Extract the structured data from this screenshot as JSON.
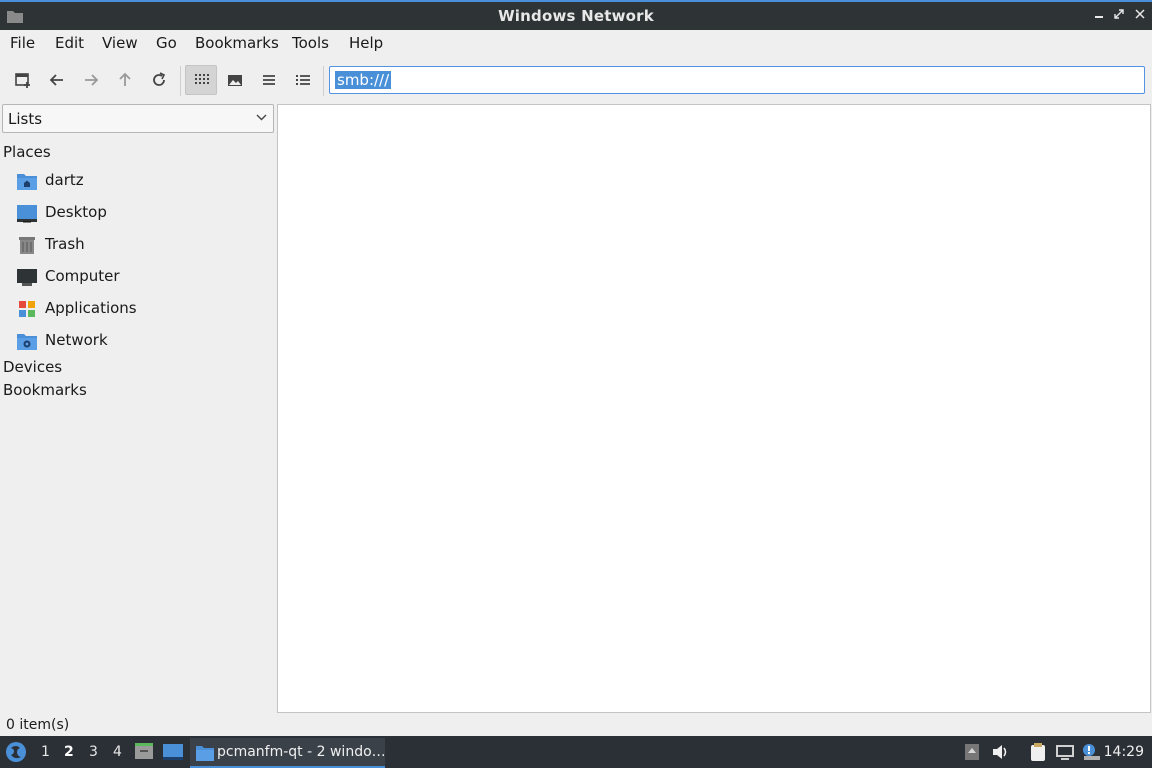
{
  "window": {
    "title": "Windows Network",
    "controls": [
      "minimize",
      "maximize",
      "close"
    ]
  },
  "menubar": {
    "items": [
      "File",
      "Edit",
      "View",
      "Go",
      "Bookmarks",
      "Tools",
      "Help"
    ]
  },
  "toolbar": {
    "buttons": [
      "new-tab-icon",
      "back-icon",
      "forward-icon",
      "up-icon",
      "reload-icon",
      "icon-view-icon",
      "thumbnail-view-icon",
      "compact-view-icon",
      "detailed-list-view-icon"
    ],
    "active_view": "icon-view",
    "address_value": "smb:///"
  },
  "sidebar": {
    "mode_select": "Lists",
    "places_heading": "Places",
    "places": [
      {
        "label": "dartz",
        "icon": "home-folder-icon"
      },
      {
        "label": "Desktop",
        "icon": "desktop-icon"
      },
      {
        "label": "Trash",
        "icon": "trash-icon"
      },
      {
        "label": "Computer",
        "icon": "computer-icon"
      },
      {
        "label": "Applications",
        "icon": "applications-icon"
      },
      {
        "label": "Network",
        "icon": "network-folder-icon"
      }
    ],
    "devices_heading": "Devices",
    "bookmarks_heading": "Bookmarks"
  },
  "statusbar": {
    "text": "0 item(s)"
  },
  "taskbar": {
    "desktops": [
      "1",
      "2",
      "3",
      "4"
    ],
    "current_desktop": "2",
    "task_label": "pcmanfm-qt - 2 windo…",
    "clock": "14:29"
  },
  "colors": {
    "accent": "#4a90d9",
    "titlebar": "#2e3436",
    "taskbar": "#2b3036",
    "window_bg": "#efefef"
  }
}
